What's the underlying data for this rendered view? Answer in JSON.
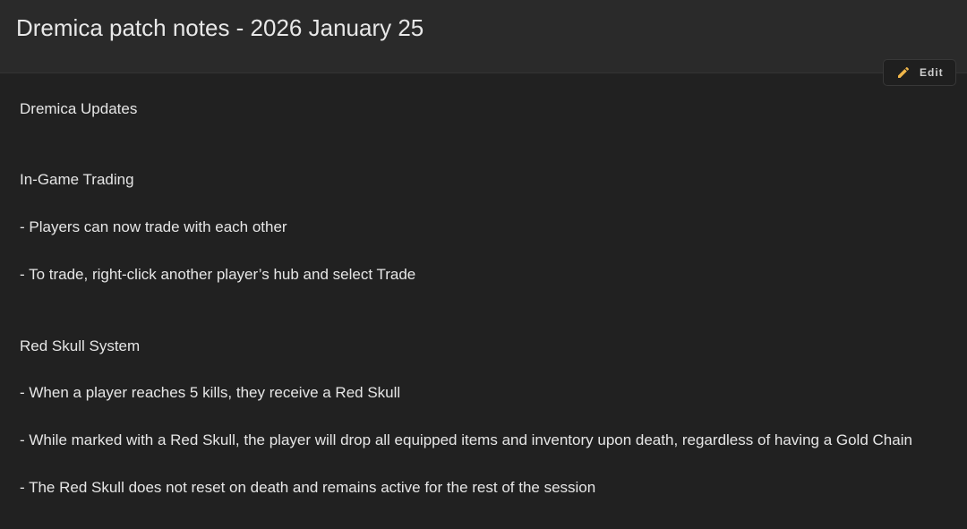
{
  "header": {
    "title": "Dremica patch notes - 2026 January 25"
  },
  "toolbar": {
    "edit_label": "Edit",
    "edit_icon": "pencil-icon",
    "edit_icon_color": "#f0b64a"
  },
  "body": {
    "heading": "Dremica Updates",
    "sections": [
      {
        "title": "In-Game Trading",
        "items": [
          "- Players can now trade with each other",
          "- To trade, right-click another player’s hub and select Trade"
        ]
      },
      {
        "title": "Red Skull System",
        "items": [
          "- When a player reaches 5 kills, they receive a Red Skull",
          "- While marked with a Red Skull, the player will drop all equipped items and inventory upon death, regardless of having a Gold Chain",
          "- The Red Skull does not reset on death and remains active for the rest of the session"
        ]
      }
    ]
  }
}
